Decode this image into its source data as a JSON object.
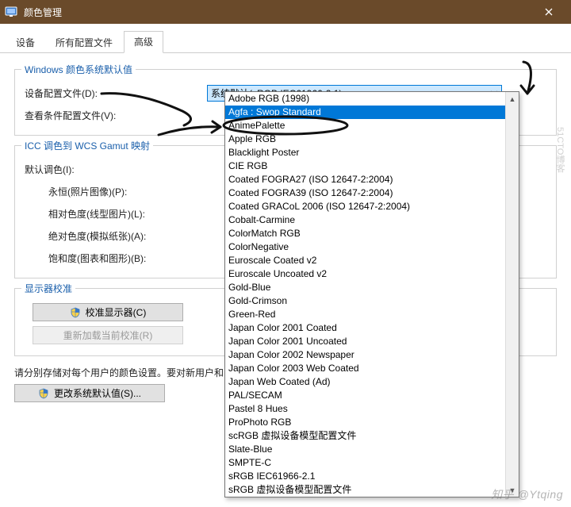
{
  "window": {
    "title": "颜色管理"
  },
  "tabs": {
    "devices": "设备",
    "allprofiles": "所有配置文件",
    "advanced": "高级"
  },
  "groups": {
    "defaults": "Windows 颜色系统默认值",
    "icc": "ICC 调色到 WCS Gamut 映射",
    "calib": "显示器校准"
  },
  "labels": {
    "deviceProfile": "设备配置文件(D):",
    "viewCond": "查看条件配置文件(V):",
    "defaultTone": "默认调色(I):",
    "perceptual": "永恒(照片图像)(P):",
    "relative": "相对色度(线型图片)(L):",
    "absolute": "绝对色度(模拟纸张)(A):",
    "saturation": "饱和度(图表和图形)(B):"
  },
  "combo": {
    "selected": "系统默认(sRGB IEC61966-2.1)"
  },
  "dropdown": {
    "selectedIndex": 1,
    "items": [
      "Adobe RGB (1998)",
      "Agfa : Swop Standard",
      "AnimePalette",
      "Apple RGB",
      "Blacklight Poster",
      "CIE RGB",
      "Coated FOGRA27 (ISO 12647-2:2004)",
      "Coated FOGRA39 (ISO 12647-2:2004)",
      "Coated GRACoL 2006 (ISO 12647-2:2004)",
      "Cobalt-Carmine",
      "ColorMatch RGB",
      "ColorNegative",
      "Euroscale Coated v2",
      "Euroscale Uncoated v2",
      "Gold-Blue",
      "Gold-Crimson",
      "Green-Red",
      "Japan Color 2001 Coated",
      "Japan Color 2001 Uncoated",
      "Japan Color 2002 Newspaper",
      "Japan Color 2003 Web Coated",
      "Japan Web Coated (Ad)",
      "PAL/SECAM",
      "Pastel 8 Hues",
      "ProPhoto RGB",
      "scRGB  虚拟设备模型配置文件",
      "Slate-Blue",
      "SMPTE-C",
      "sRGB IEC61966-2.1",
      "sRGB 虚拟设备模型配置文件"
    ]
  },
  "buttons": {
    "calibrate": "校准显示器(C)",
    "reload": "重新加载当前校准(R)",
    "changeDefaults": "更改系统默认值(S)..."
  },
  "note": "请分别存储对每个用户的颜色设置。要对新用户和",
  "watermark": "知乎 @Ytqing",
  "watermark2": "51CTO博客"
}
